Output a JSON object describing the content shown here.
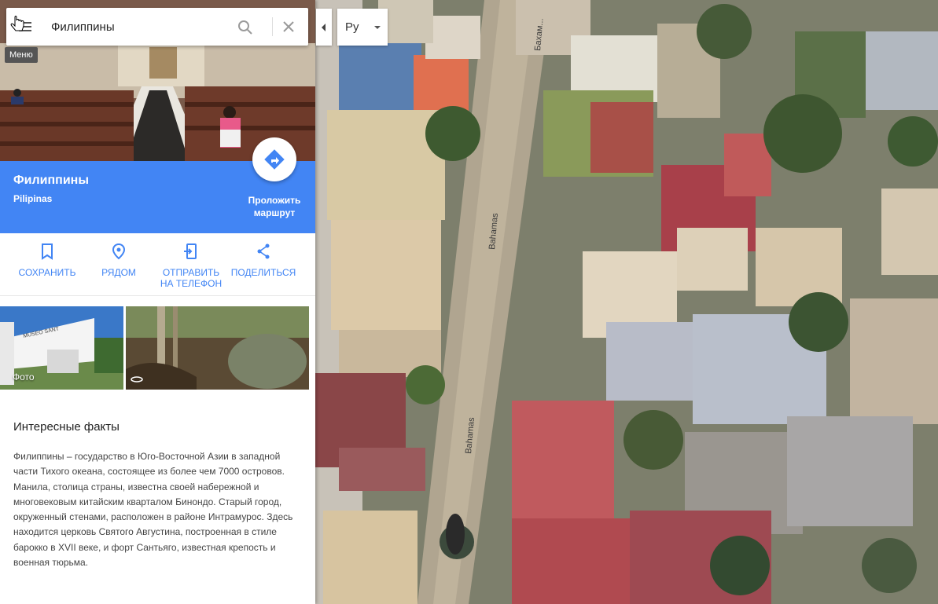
{
  "search": {
    "value": "Филиппины",
    "menu_tooltip": "Меню"
  },
  "place": {
    "title": "Филиппины",
    "subtitle": "Pilipinas",
    "route_label": "Проложить маршрут"
  },
  "actions": [
    {
      "label": "СОХРАНИТЬ",
      "icon": "bookmark-icon"
    },
    {
      "label": "РЯДОМ",
      "icon": "nearby-pin-icon"
    },
    {
      "label": "ОТПРАВИТЬ НА ТЕЛЕФОН",
      "icon": "send-to-phone-icon"
    },
    {
      "label": "ПОДЕЛИТЬСЯ",
      "icon": "share-icon"
    }
  ],
  "photos": {
    "photo_label": "Фото",
    "panorama_icon": "360-icon"
  },
  "facts": {
    "heading": "Интересные факты",
    "text": "Филиппины – государство в Юго-Восточной Азии в западной части Тихого океана, состоящее из более чем 7000 островов. Манила, столица страны, известна своей набережной и многовековым китайским кварталом Бинондо. Старый город, окруженный стенами, расположен в районе Интрамурос. Здесь находится церковь Святого Августина, построенная в стиле барокко в XVII веке, и форт Сантьяго, известная крепость и военная тюрьма."
  },
  "map": {
    "language": "Ру",
    "road_labels": [
      "Бахам...",
      "Bahamas",
      "Bahamas"
    ]
  },
  "colors": {
    "accent": "#4285f4",
    "text": "#444444"
  }
}
